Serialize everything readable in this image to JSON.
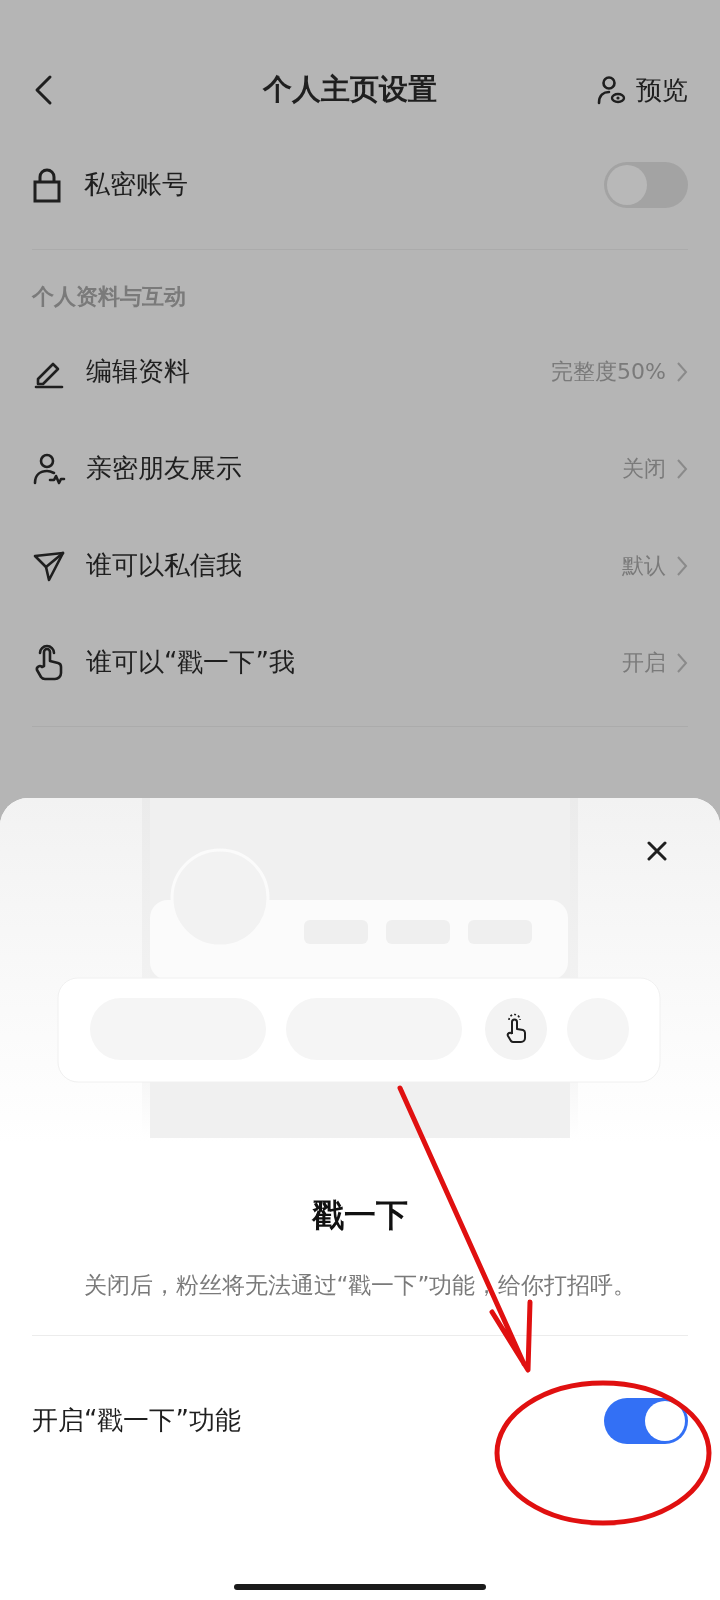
{
  "nav": {
    "title": "个人主页设置",
    "preview": "预览"
  },
  "private_account": {
    "label": "私密账号",
    "on": false
  },
  "section": {
    "title": "个人资料与互动"
  },
  "items": [
    {
      "kind": "edit",
      "label": "编辑资料",
      "value": "完整度50%"
    },
    {
      "kind": "friends",
      "label": "亲密朋友展示",
      "value": "关闭"
    },
    {
      "kind": "message",
      "label": "谁可以私信我",
      "value": "默认"
    },
    {
      "kind": "poke",
      "label": "谁可以“戳一下”我",
      "value": "开启"
    }
  ],
  "sheet": {
    "title": "戳一下",
    "description": "关闭后，粉丝将无法通过“戳一下”功能，给你打招呼。",
    "toggle": {
      "label": "开启“戳一下”功能",
      "on": true
    }
  }
}
